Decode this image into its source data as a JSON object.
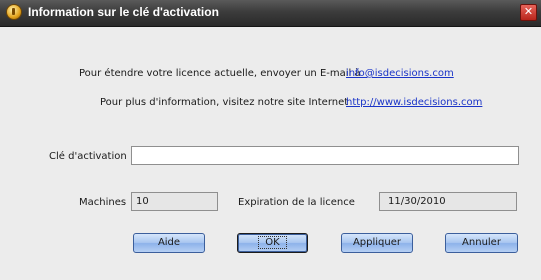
{
  "window": {
    "title": "Information sur le clé d'activation",
    "close_glyph": "✕",
    "icon": "info-app-icon"
  },
  "info": {
    "email_text": "Pour étendre votre licence actuelle, envoyer un E-mail à",
    "email_link": "info@isdecisions.com",
    "web_text": "Pour plus d'information, visitez notre site Internet",
    "web_link": "http://www.isdecisions.com"
  },
  "activation": {
    "label": "Clé d'activation",
    "value": ""
  },
  "machines": {
    "label": "Machines",
    "value": "10"
  },
  "expiration": {
    "label": "Expiration de la licence",
    "value": "11/30/2010"
  },
  "buttons": {
    "help": "Aide",
    "ok": "OK",
    "apply": "Appliquer",
    "cancel": "Annuler"
  },
  "colors": {
    "titlebar": "#3c3c3c",
    "link": "#1a34c8",
    "button": "#a9c6f0"
  }
}
